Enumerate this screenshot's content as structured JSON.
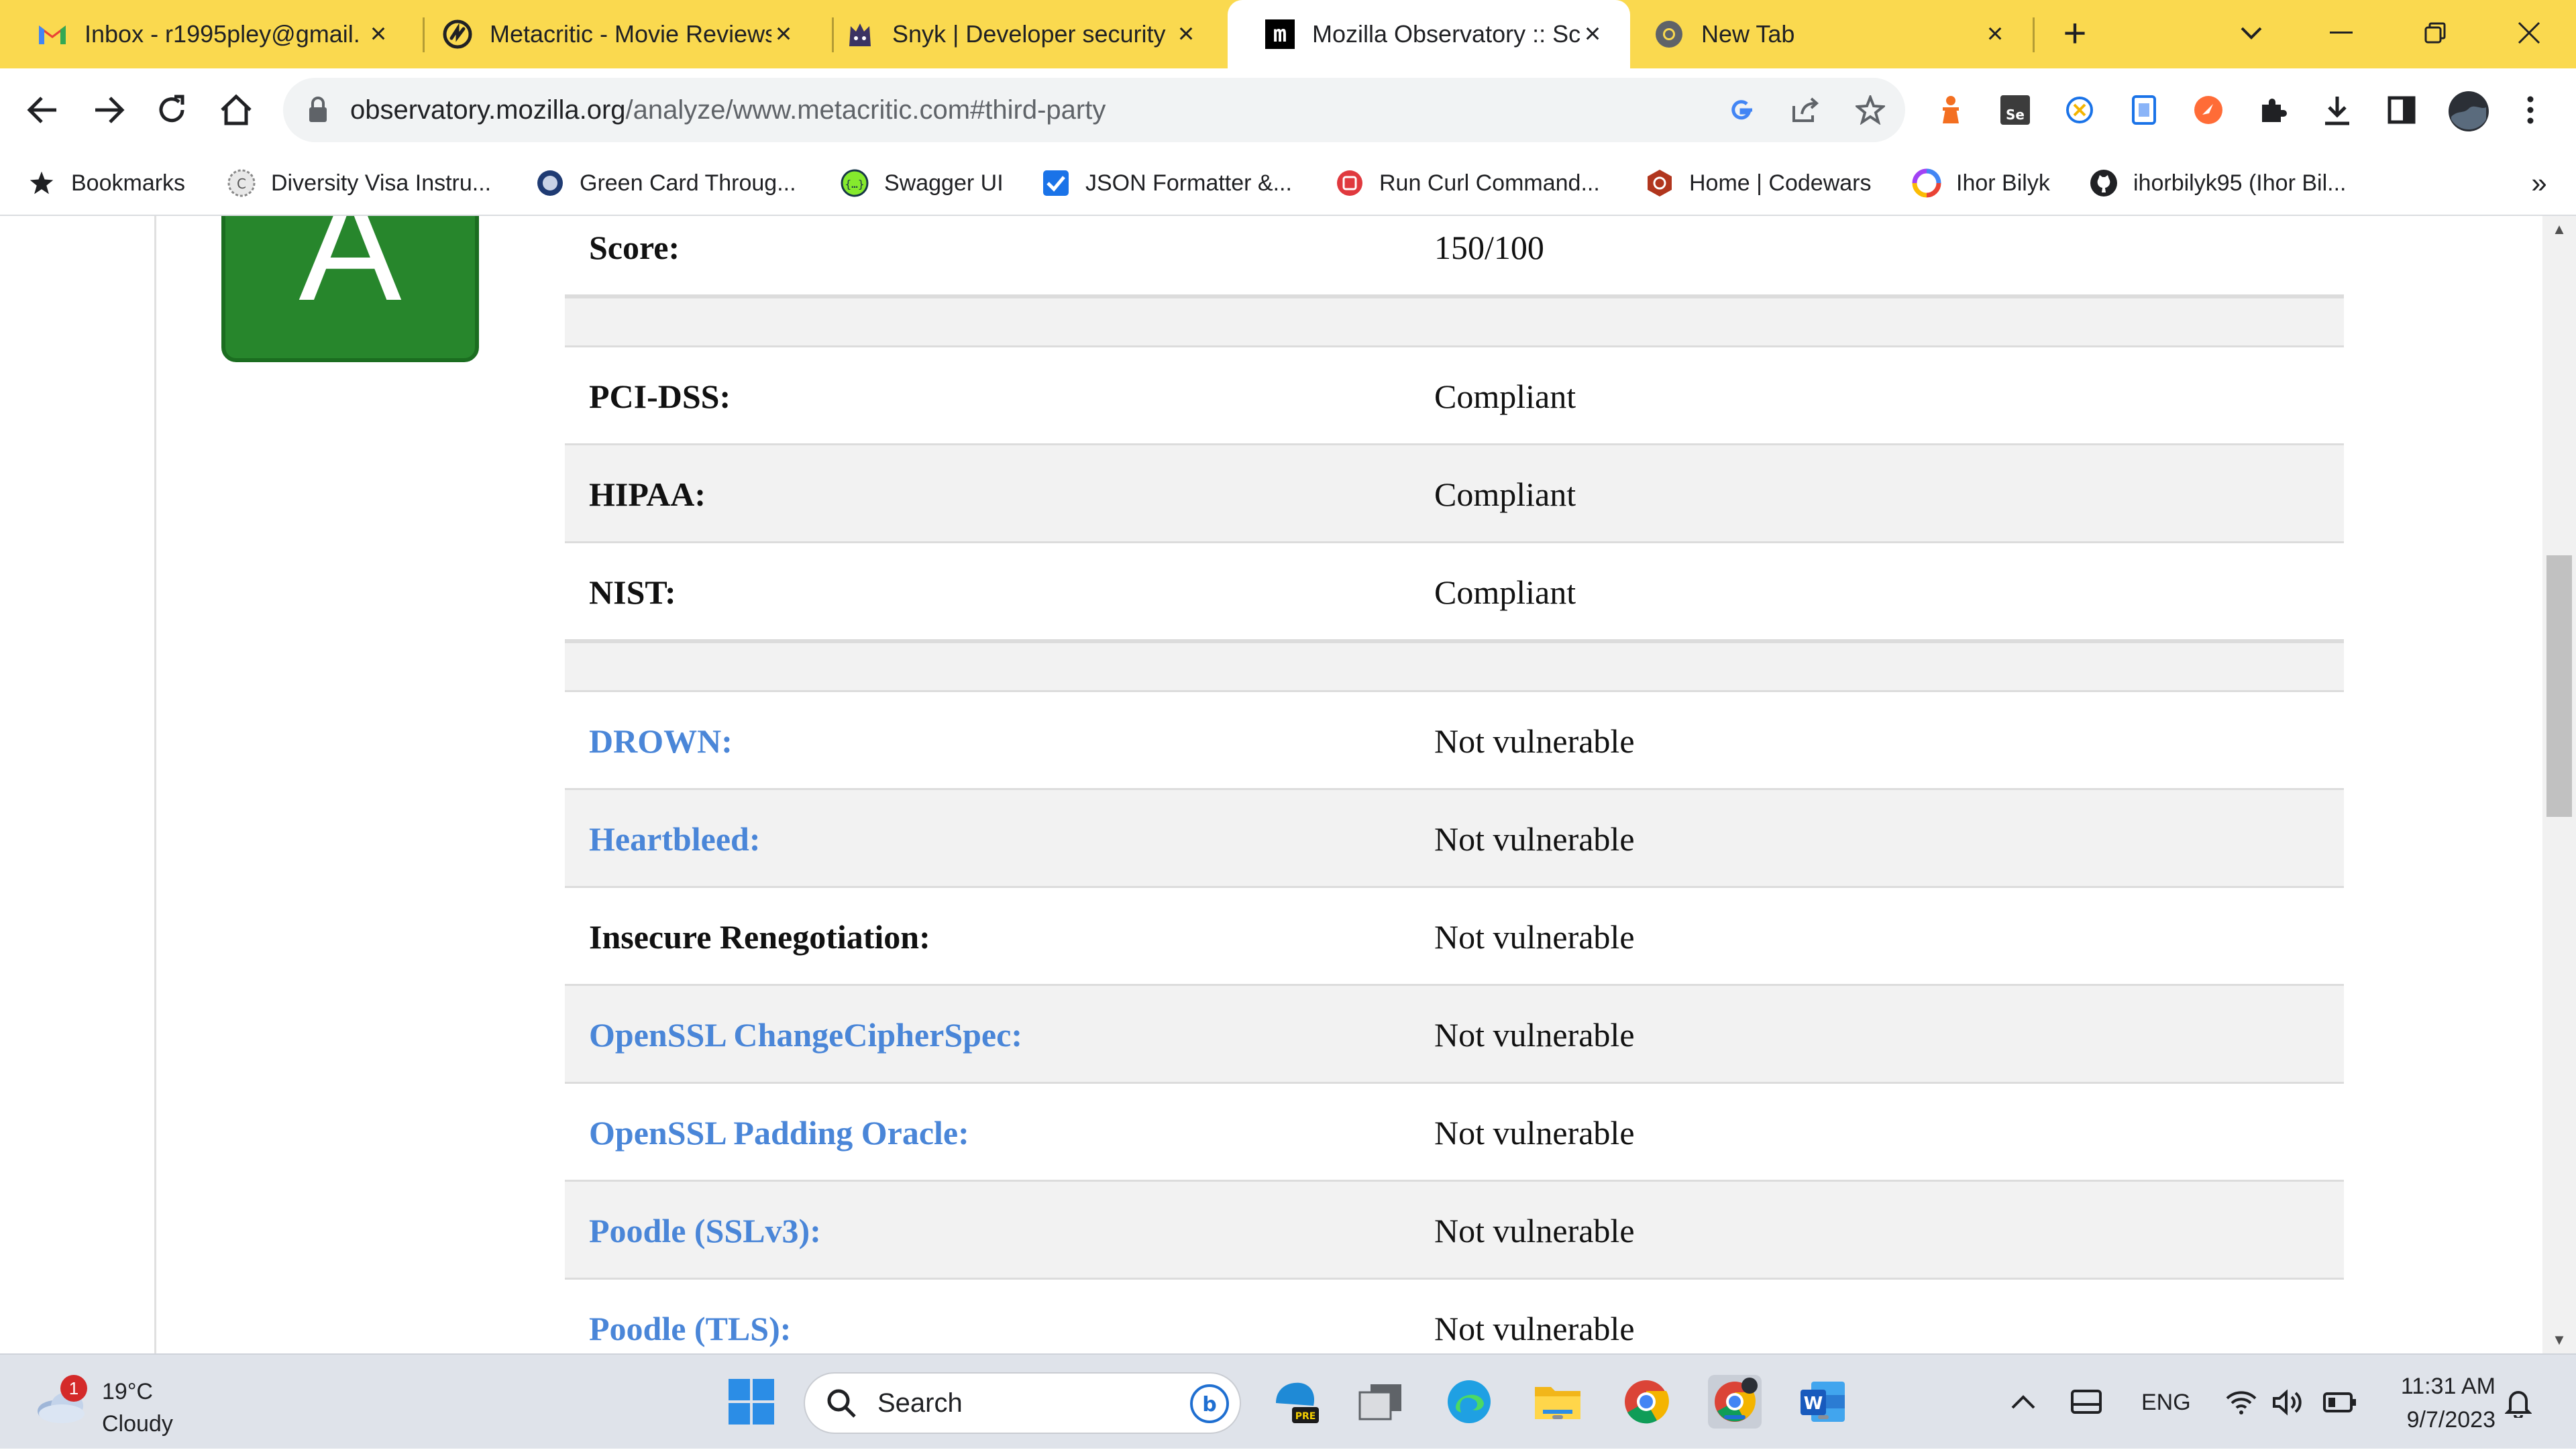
{
  "tabs": [
    {
      "title": "Inbox - r1995pley@gmail.",
      "favicon": "gmail-icon"
    },
    {
      "title": "Metacritic - Movie Reviews",
      "favicon": "metacritic-icon"
    },
    {
      "title": "Snyk | Developer security",
      "favicon": "snyk-icon"
    },
    {
      "title": "Mozilla Observatory :: Sca",
      "favicon": "mozilla-m-icon",
      "favicon_text": "m",
      "active": true
    },
    {
      "title": "New Tab",
      "favicon": "chrome-icon"
    }
  ],
  "window": {
    "new_tab": "+",
    "dropdown": "⌄",
    "minimize": "—",
    "restore": "❐",
    "close": "✕"
  },
  "address": {
    "host": "observatory.mozilla.org",
    "path": "/analyze/www.metacritic.com#third-party"
  },
  "bookmarks": [
    {
      "label": "Bookmarks",
      "icon": "star-icon"
    },
    {
      "label": "Diversity Visa Instru...",
      "icon": "dv-icon"
    },
    {
      "label": "Green Card Throug...",
      "icon": "uscis-icon"
    },
    {
      "label": "Swagger UI",
      "icon": "swagger-icon"
    },
    {
      "label": "JSON Formatter &...",
      "icon": "checkbox-icon"
    },
    {
      "label": "Run Curl Command...",
      "icon": "curl-icon"
    },
    {
      "label": "Home | Codewars",
      "icon": "codewars-icon"
    },
    {
      "label": "Ihor Bilyk",
      "icon": "swirl-icon"
    },
    {
      "label": "ihorbilyk95 (Ihor Bil...",
      "icon": "github-icon"
    }
  ],
  "bookmarks_more": "»",
  "grade": {
    "letter": "A",
    "color": "#27862c"
  },
  "rows": [
    {
      "key": "Score:",
      "value": "150/100",
      "link": false,
      "shade": false
    },
    {
      "spacer": true
    },
    {
      "key": "PCI-DSS:",
      "value": "Compliant",
      "link": false,
      "shade": false
    },
    {
      "key": "HIPAA:",
      "value": "Compliant",
      "link": false,
      "shade": true
    },
    {
      "key": "NIST:",
      "value": "Compliant",
      "link": false,
      "shade": false
    },
    {
      "spacer": true
    },
    {
      "key": "DROWN:",
      "value": "Not vulnerable",
      "link": true,
      "shade": false
    },
    {
      "key": "Heartbleed:",
      "value": "Not vulnerable",
      "link": true,
      "shade": true
    },
    {
      "key": "Insecure Renegotiation:",
      "value": "Not vulnerable",
      "link": false,
      "shade": false
    },
    {
      "key": "OpenSSL ChangeCipherSpec:",
      "value": "Not vulnerable",
      "link": true,
      "shade": true
    },
    {
      "key": "OpenSSL Padding Oracle:",
      "value": "Not vulnerable",
      "link": true,
      "shade": false
    },
    {
      "key": "Poodle (SSLv3):",
      "value": "Not vulnerable",
      "link": true,
      "shade": true
    },
    {
      "key": "Poodle (TLS):",
      "value": "Not vulnerable",
      "link": true,
      "shade": false
    }
  ],
  "colors": {
    "link": "#4a86d8",
    "tabstrip": "#fad94f",
    "taskbar": "#dfe3ea"
  },
  "taskbar": {
    "weather_badge": "1",
    "temperature": "19°C",
    "condition": "Cloudy",
    "search_label": "Search",
    "language": "ENG",
    "time": "11:31 AM",
    "date": "9/7/2023",
    "store_badge": "PRE"
  }
}
